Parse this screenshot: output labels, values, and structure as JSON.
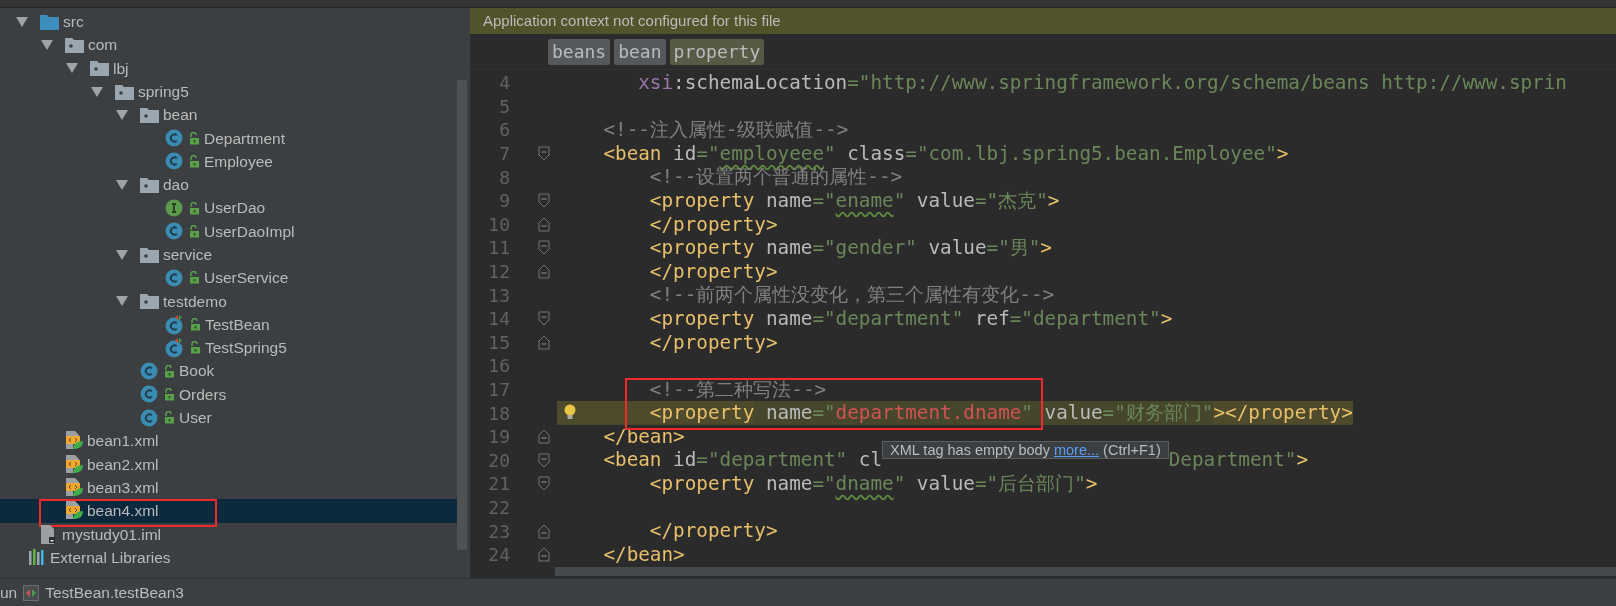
{
  "tree": [
    {
      "label": "src",
      "kind": "src-folder",
      "expanded": true,
      "selected": false,
      "framed": false,
      "children": [
        {
          "label": "com",
          "kind": "package",
          "expanded": true,
          "selected": false,
          "framed": false,
          "children": [
            {
              "label": "lbj",
              "kind": "package",
              "expanded": true,
              "selected": false,
              "framed": false,
              "children": [
                {
                  "label": "spring5",
                  "kind": "package",
                  "expanded": true,
                  "selected": false,
                  "framed": false,
                  "children": [
                    {
                      "label": "bean",
                      "kind": "package",
                      "expanded": true,
                      "selected": false,
                      "framed": false,
                      "children": [
                        {
                          "label": "Department",
                          "kind": "class",
                          "selected": false,
                          "framed": false
                        },
                        {
                          "label": "Employee",
                          "kind": "class",
                          "selected": false,
                          "framed": false
                        }
                      ]
                    },
                    {
                      "label": "dao",
                      "kind": "package",
                      "expanded": true,
                      "selected": false,
                      "framed": false,
                      "children": [
                        {
                          "label": "UserDao",
                          "kind": "interface",
                          "selected": false,
                          "framed": false
                        },
                        {
                          "label": "UserDaoImpl",
                          "kind": "class",
                          "selected": false,
                          "framed": false
                        }
                      ]
                    },
                    {
                      "label": "service",
                      "kind": "package",
                      "expanded": true,
                      "selected": false,
                      "framed": false,
                      "children": [
                        {
                          "label": "UserService",
                          "kind": "class",
                          "selected": false,
                          "framed": false
                        }
                      ]
                    },
                    {
                      "label": "testdemo",
                      "kind": "package",
                      "expanded": true,
                      "selected": false,
                      "framed": false,
                      "children": [
                        {
                          "label": "TestBean",
                          "kind": "test-class",
                          "selected": false,
                          "framed": false
                        },
                        {
                          "label": "TestSpring5",
                          "kind": "test-class",
                          "selected": false,
                          "framed": false
                        }
                      ]
                    },
                    {
                      "label": "Book",
                      "kind": "class",
                      "selected": false,
                      "framed": false
                    },
                    {
                      "label": "Orders",
                      "kind": "class",
                      "selected": false,
                      "framed": false
                    },
                    {
                      "label": "User",
                      "kind": "class",
                      "selected": false,
                      "framed": false
                    }
                  ]
                }
              ]
            }
          ]
        },
        {
          "label": "bean1.xml",
          "kind": "xml",
          "selected": false,
          "framed": false
        },
        {
          "label": "bean2.xml",
          "kind": "xml",
          "selected": false,
          "framed": false
        },
        {
          "label": "bean3.xml",
          "kind": "xml",
          "selected": false,
          "framed": false
        },
        {
          "label": "bean4.xml",
          "kind": "xml",
          "selected": true,
          "framed": true
        }
      ]
    },
    {
      "label": "mystudy01.iml",
      "kind": "iml",
      "selected": false,
      "framed": false
    }
  ],
  "outer_items": [
    {
      "label": "External Libraries",
      "kind": "library",
      "selected": false,
      "framed": false
    }
  ],
  "notification": "Application context not configured for this file",
  "breadcrumbs": [
    {
      "label": "beans",
      "selected": false
    },
    {
      "label": "bean",
      "selected": false
    },
    {
      "label": "property",
      "selected": true
    }
  ],
  "lines": [
    {
      "number": "4",
      "highlighted": false,
      "framed": false,
      "bulb": false,
      "fold_start": false,
      "fold_end": false,
      "tokens": [
        {
          "kind": "ns",
          "text": "       xsi"
        },
        {
          "kind": "attr",
          "text": ":schemaLocation"
        },
        {
          "kind": "value",
          "text": "=\"http://www.springframework.org/schema/beans http://www.sprin"
        }
      ]
    },
    {
      "number": "5",
      "framed": false,
      "bulb": false,
      "fold_start": false,
      "fold_end": false
    },
    {
      "number": "6",
      "highlighted": false,
      "framed": false,
      "bulb": false,
      "fold_start": false,
      "fold_end": false,
      "tokens": [
        {
          "kind": "comment",
          "text": "    <!--注入属性-级联赋值-->"
        }
      ]
    },
    {
      "number": "7",
      "highlighted": false,
      "framed": false,
      "bulb": false,
      "fold_start": true,
      "fold_end": false,
      "tokens": [
        {
          "kind": "tag",
          "text": "    <bean"
        },
        {
          "kind": "attr",
          "text": " id"
        },
        {
          "kind": "value",
          "text": "=\""
        },
        {
          "kind": "value",
          "text": "employeee",
          "typo": true
        },
        {
          "kind": "value",
          "text": "\""
        },
        {
          "kind": "attr",
          "text": " class"
        },
        {
          "kind": "value",
          "text": "=\"com.lbj.spring5.bean.Employee\""
        },
        {
          "kind": "tag",
          "text": ">"
        }
      ]
    },
    {
      "number": "8",
      "highlighted": false,
      "framed": false,
      "bulb": false,
      "fold_start": false,
      "fold_end": false,
      "tokens": [
        {
          "kind": "comment",
          "text": "        <!--设置两个普通的属性-->"
        }
      ]
    },
    {
      "number": "9",
      "highlighted": false,
      "framed": false,
      "bulb": false,
      "fold_start": true,
      "fold_end": false,
      "tokens": [
        {
          "kind": "tag",
          "text": "        <property"
        },
        {
          "kind": "attr",
          "text": " name"
        },
        {
          "kind": "value",
          "text": "=\""
        },
        {
          "kind": "value",
          "text": "ename",
          "typo": true
        },
        {
          "kind": "value",
          "text": "\""
        },
        {
          "kind": "attr",
          "text": " value"
        },
        {
          "kind": "value",
          "text": "=\"杰克\""
        },
        {
          "kind": "tag",
          "text": ">"
        }
      ]
    },
    {
      "number": "10",
      "highlighted": false,
      "framed": false,
      "bulb": false,
      "fold_start": false,
      "fold_end": true,
      "tokens": [
        {
          "kind": "tag",
          "text": "        </property>"
        }
      ]
    },
    {
      "number": "11",
      "highlighted": false,
      "framed": false,
      "bulb": false,
      "fold_start": true,
      "fold_end": false,
      "tokens": [
        {
          "kind": "tag",
          "text": "        <property"
        },
        {
          "kind": "attr",
          "text": " name"
        },
        {
          "kind": "value",
          "text": "=\"gender\""
        },
        {
          "kind": "attr",
          "text": " value"
        },
        {
          "kind": "value",
          "text": "=\"男\""
        },
        {
          "kind": "tag",
          "text": ">"
        }
      ]
    },
    {
      "number": "12",
      "highlighted": false,
      "framed": false,
      "bulb": false,
      "fold_start": false,
      "fold_end": true,
      "tokens": [
        {
          "kind": "tag",
          "text": "        </property>"
        }
      ]
    },
    {
      "number": "13",
      "highlighted": false,
      "framed": false,
      "bulb": false,
      "fold_start": false,
      "fold_end": false,
      "tokens": [
        {
          "kind": "comment",
          "text": "        <!--前两个属性没变化，第三个属性有变化-->"
        }
      ]
    },
    {
      "number": "14",
      "highlighted": false,
      "framed": false,
      "bulb": false,
      "fold_start": true,
      "fold_end": false,
      "tokens": [
        {
          "kind": "tag",
          "text": "        <property"
        },
        {
          "kind": "attr",
          "text": " name"
        },
        {
          "kind": "value",
          "text": "=\"department\""
        },
        {
          "kind": "attr",
          "text": " ref"
        },
        {
          "kind": "value",
          "text": "=\"department\""
        },
        {
          "kind": "tag",
          "text": ">"
        }
      ]
    },
    {
      "number": "15",
      "highlighted": false,
      "framed": false,
      "bulb": false,
      "fold_start": false,
      "fold_end": true,
      "tokens": [
        {
          "kind": "tag",
          "text": "        </property>"
        }
      ]
    },
    {
      "number": "16",
      "framed": false,
      "bulb": false,
      "fold_start": false,
      "fold_end": false
    },
    {
      "number": "17",
      "highlighted": false,
      "framed": true,
      "bulb": false,
      "fold_start": false,
      "fold_end": false,
      "tokens": [
        {
          "kind": "comment",
          "text": "        <!--第二种写法-->"
        }
      ]
    },
    {
      "number": "18",
      "highlighted": true,
      "framed": true,
      "bulb": true,
      "fold_start": false,
      "fold_end": false,
      "tokens": [
        {
          "kind": "tag",
          "text": "        <property"
        },
        {
          "kind": "attr",
          "text": " name"
        },
        {
          "kind": "value",
          "text": "=\""
        },
        {
          "kind": "error",
          "text": "department.dname"
        },
        {
          "kind": "value",
          "text": "\""
        },
        {
          "kind": "attr",
          "text": " value"
        },
        {
          "kind": "value",
          "text": "=\"财务部门\""
        },
        {
          "kind": "tag",
          "text": "></property>"
        }
      ]
    },
    {
      "number": "19",
      "highlighted": false,
      "framed": false,
      "bulb": false,
      "fold_start": false,
      "fold_end": true,
      "tokens": [
        {
          "kind": "tag",
          "text": "    </bean>"
        }
      ]
    },
    {
      "number": "20",
      "highlighted": false,
      "framed": false,
      "bulb": false,
      "fold_start": true,
      "fold_end": false,
      "tokens": [
        {
          "kind": "tag",
          "text": "    <bean"
        },
        {
          "kind": "attr",
          "text": " id"
        },
        {
          "kind": "value",
          "text": "=\"department\""
        },
        {
          "kind": "attr",
          "text": " cl"
        },
        {
          "kind": "covered"
        },
        {
          "kind": "value",
          "text": "Department\""
        },
        {
          "kind": "tag",
          "text": ">"
        }
      ]
    },
    {
      "number": "21",
      "highlighted": false,
      "framed": false,
      "bulb": false,
      "fold_start": true,
      "fold_end": false,
      "tokens": [
        {
          "kind": "tag",
          "text": "        <property"
        },
        {
          "kind": "attr",
          "text": " name"
        },
        {
          "kind": "value",
          "text": "=\""
        },
        {
          "kind": "value",
          "text": "dname",
          "typo": true
        },
        {
          "kind": "value",
          "text": "\""
        },
        {
          "kind": "attr",
          "text": " value"
        },
        {
          "kind": "value",
          "text": "=\"后台部门\""
        },
        {
          "kind": "tag",
          "text": ">"
        }
      ]
    },
    {
      "number": "22",
      "framed": false,
      "bulb": false,
      "fold_start": false,
      "fold_end": false
    },
    {
      "number": "23",
      "highlighted": false,
      "framed": false,
      "bulb": false,
      "fold_start": false,
      "fold_end": true,
      "tokens": [
        {
          "kind": "tag",
          "text": "        </property>"
        }
      ]
    },
    {
      "number": "24",
      "highlighted": false,
      "framed": false,
      "bulb": false,
      "fold_start": false,
      "fold_end": true,
      "tokens": [
        {
          "kind": "tag",
          "text": "    </bean>"
        }
      ]
    }
  ],
  "tooltip": {
    "text": "XML tag has empty body",
    "link": "more...",
    "shortcut": "(Ctrl+F1)"
  },
  "status_bar": {
    "tool_tab": "un",
    "run_config": "TestBean.testBean3"
  }
}
